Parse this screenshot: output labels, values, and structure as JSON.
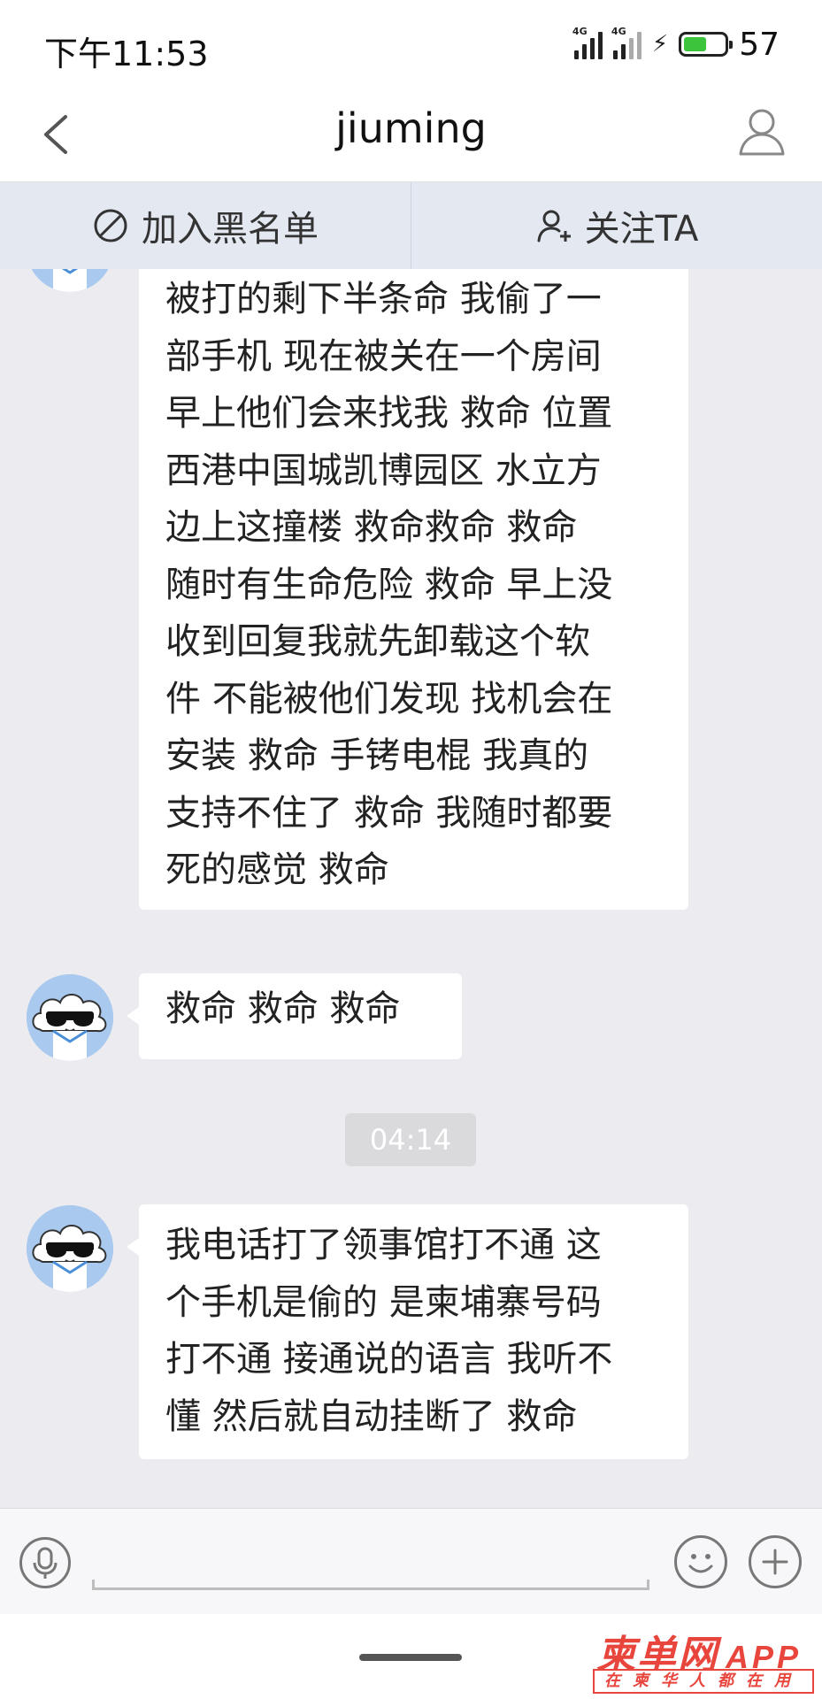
{
  "status_bar": {
    "time": "下午11:53",
    "signal1_tag": "4G",
    "signal2_tag": "4G",
    "battery_level": "57",
    "battery_color": "#3cc43c"
  },
  "header": {
    "title": "jiuming",
    "back_icon": "chevron-left-icon",
    "profile_icon": "person-icon"
  },
  "actions": {
    "blacklist_label": "加入黑名单",
    "follow_label": "关注TA"
  },
  "messages": [
    {
      "lines": [
        "被打的剩下半条命 我偷了一",
        "部手机 现在被关在一个房间",
        "早上他们会来找我 救命 位置",
        "西港中国城凯博园区 水立方",
        "边上这撞楼 救命救命 救命",
        "随时有生命危险 救命 早上没",
        "收到回复我就先卸载这个软",
        "件 不能被他们发现 找机会在",
        "安装 救命 手铐电棍 我真的",
        "支持不住了 救命 我随时都要",
        "死的感觉 救命"
      ]
    },
    {
      "lines": [
        "救命 救命 救命"
      ]
    },
    {
      "lines": [
        "我电话打了领事馆打不通 这",
        "个手机是偷的 是柬埔寨号码",
        "打不通 接通说的语言 我听不",
        "懂 然后就自动挂断了 救命"
      ]
    }
  ],
  "timestamp": "04:14",
  "watermark": {
    "main": "柬单网",
    "app": "APP",
    "sub": "在柬华人都在用"
  }
}
